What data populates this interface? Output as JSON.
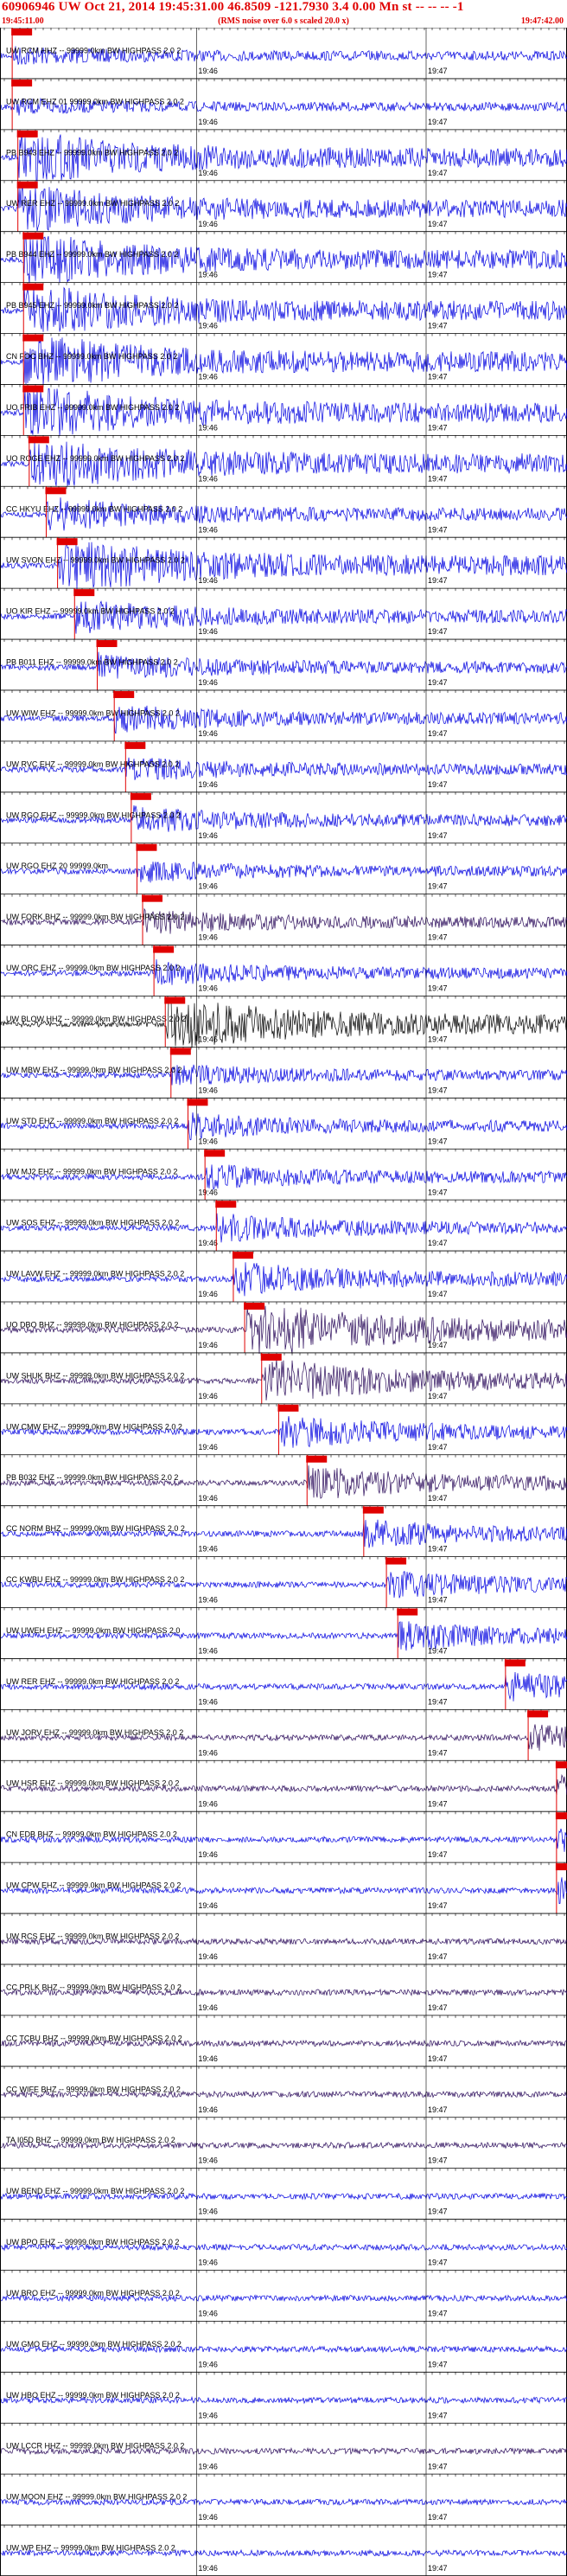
{
  "header": {
    "title": "60906946 UW Oct 21, 2014 19:45:31.00   46.8509 -121.7930  3.4 0.00 Mn st -- -- --   -1",
    "start_time": "19:45:11.00",
    "end_time": "19:47:42.00",
    "note": "(RMS noise over 6.0 s scaled 20.0 x)"
  },
  "minute_labels": [
    "19:46",
    "19:47"
  ],
  "colors": {
    "blue": "#0000e0",
    "purple": "#2a0a5a",
    "black": "#000000",
    "pick": "#e00000"
  },
  "traces": [
    {
      "label": "UW RCM HHZ -- 99999.0km BW HIGHPASS 2.0 2",
      "color": "blue",
      "amp": 0.25,
      "pick": 0.02
    },
    {
      "label": "UW RCM EHZ 01 99999.0km BW HIGHPASS 2.0 2",
      "color": "blue",
      "amp": 0.2,
      "pick": 0.02
    },
    {
      "label": "PB B943 EHZ -- 99999.0km BW HIGHPASS 2.0 2",
      "color": "blue",
      "amp": 0.9,
      "pick": 0.03
    },
    {
      "label": "UW RER EHZ -- 99999.0km BW HIGHPASS 2.0 2",
      "color": "blue",
      "amp": 0.8,
      "pick": 0.03
    },
    {
      "label": "PB B944 EHZ -- 99999.0km BW HIGHPASS 2.0 2",
      "color": "blue",
      "amp": 0.9,
      "pick": 0.04
    },
    {
      "label": "PB B945 EHZ -- 99999.0km BW HIGHPASS 2.0 2",
      "color": "blue",
      "amp": 0.9,
      "pick": 0.04
    },
    {
      "label": "CN FOC BHZ -- 99999.0km BW HIGHPASS 2.0 2",
      "color": "blue",
      "amp": 0.95,
      "pick": 0.04
    },
    {
      "label": "UO FRIB EHZ -- 99999.0km BW HIGHPASS 2.0 2",
      "color": "blue",
      "amp": 0.95,
      "pick": 0.04
    },
    {
      "label": "UO ROGE EHZ -- 99999.0km BW HIGHPASS 2.0 2",
      "color": "blue",
      "amp": 0.95,
      "pick": 0.05
    },
    {
      "label": "CC HKYU EHZ -- 99999.0km BW HIGHPASS 2.0 2",
      "color": "blue",
      "amp": 0.5,
      "pick": 0.08
    },
    {
      "label": "UW SVON EHZ -- 99999.0km BW HIGHPASS 2.0 2",
      "color": "blue",
      "amp": 0.95,
      "pick": 0.1
    },
    {
      "label": "UO KIR EHZ -- 99999.0km BW HIGHPASS 2.0 2",
      "color": "blue",
      "amp": 0.5,
      "pick": 0.13
    },
    {
      "label": "PB B011 EHZ -- 99999.0km BW HIGHPASS 2.0 2",
      "color": "blue",
      "amp": 0.4,
      "pick": 0.17
    },
    {
      "label": "UW WIW EHZ -- 99999.0km BW HIGHPASS 2.0 2",
      "color": "blue",
      "amp": 0.4,
      "pick": 0.2
    },
    {
      "label": "UW RVC EHZ -- 99999.0km BW HIGHPASS 2.0 2",
      "color": "blue",
      "amp": 0.35,
      "pick": 0.22
    },
    {
      "label": "UW RGO EHZ -- 99999.0km BW HIGHPASS 2.0 2",
      "color": "blue",
      "amp": 0.4,
      "pick": 0.23
    },
    {
      "label": "UW RGO EHZ 20 99999.0km",
      "color": "blue",
      "amp": 0.3,
      "pick": 0.24
    },
    {
      "label": "UW FORK BHZ -- 99999.0km BW HIGHPASS 2.0 2",
      "color": "purple",
      "amp": 0.35,
      "pick": 0.25
    },
    {
      "label": "UW ORC EHZ -- 99999.0km BW HIGHPASS 2.0 2",
      "color": "blue",
      "amp": 0.35,
      "pick": 0.27
    },
    {
      "label": "UW BLOW HHZ -- 99999.0km BW HIGHPASS 2.0 2",
      "color": "black",
      "amp": 0.9,
      "pick": 0.29
    },
    {
      "label": "UW MBW EHZ -- 99999.0km BW HIGHPASS 2.0 2",
      "color": "blue",
      "amp": 0.3,
      "pick": 0.3
    },
    {
      "label": "UW STD EHZ -- 99999.0km BW HIGHPASS 2.0 2",
      "color": "blue",
      "amp": 0.35,
      "pick": 0.33
    },
    {
      "label": "UW MJ2 EHZ -- 99999.0km BW HIGHPASS 2.0 2",
      "color": "blue",
      "amp": 0.35,
      "pick": 0.36
    },
    {
      "label": "UW SOS EHZ -- 99999.0km BW HIGHPASS 2.0 2",
      "color": "blue",
      "amp": 0.4,
      "pick": 0.38
    },
    {
      "label": "UW LAVW EHZ -- 99999.0km BW HIGHPASS 2.0 2",
      "color": "blue",
      "amp": 0.5,
      "pick": 0.41
    },
    {
      "label": "UO DBO BHZ -- 99999.0km BW HIGHPASS 2.0 2",
      "color": "purple",
      "amp": 0.95,
      "pick": 0.43
    },
    {
      "label": "UW SHUK BHZ -- 99999.0km BW HIGHPASS 2.0 2",
      "color": "purple",
      "amp": 0.7,
      "pick": 0.46
    },
    {
      "label": "UW CMW EHZ -- 99999.0km BW HIGHPASS 2.0 2",
      "color": "blue",
      "amp": 0.5,
      "pick": 0.49
    },
    {
      "label": "PB B032 EHZ -- 99999.0km BW HIGHPASS 2.0 2",
      "color": "purple",
      "amp": 0.5,
      "pick": 0.54
    },
    {
      "label": "CC NORM BHZ -- 99999.0km BW HIGHPASS 2.0 2",
      "color": "blue",
      "amp": 0.4,
      "pick": 0.64
    },
    {
      "label": "CC KWBU EHZ -- 99999.0km BW HIGHPASS 2.0 2",
      "color": "blue",
      "amp": 0.4,
      "pick": 0.68
    },
    {
      "label": "UW UWEH EHZ -- 99999.0km BW HIGHPASS 2.0",
      "color": "blue",
      "amp": 0.45,
      "pick": 0.7
    },
    {
      "label": "UW RER EHZ -- 99999.0km BW HIGHPASS 2.0 2",
      "color": "blue",
      "amp": 0.4,
      "pick": 0.89
    },
    {
      "label": "UW JORV EHZ -- 99999.0km BW HIGHPASS 2.0 2",
      "color": "purple",
      "amp": 0.35,
      "pick": 0.93
    },
    {
      "label": "UW HSR EHZ -- 99999.0km BW HIGHPASS 2.0 2",
      "color": "purple",
      "amp": 0.35,
      "pick": 0.98
    },
    {
      "label": "CN EDB BHZ -- 99999.0km BW HIGHPASS 2.0 2",
      "color": "blue",
      "amp": 0.35,
      "pick": 0.98
    },
    {
      "label": "UW CPW EHZ -- 99999.0km BW HIGHPASS 2.0 2",
      "color": "blue",
      "amp": 0.35,
      "pick": 0.98
    },
    {
      "label": "UW RCS EHZ -- 99999.0km BW HIGHPASS 2.0 2",
      "color": "purple",
      "amp": 0.55,
      "pick": null
    },
    {
      "label": "CC PRLK BHZ -- 99999.0km BW HIGHPASS 2.0 2",
      "color": "purple",
      "amp": 0.3,
      "pick": null
    },
    {
      "label": "CC TCBU BHZ -- 99999.0km BW HIGHPASS 2.0 2",
      "color": "purple",
      "amp": 0.3,
      "pick": null
    },
    {
      "label": "CC WIFE BHZ -- 99999.0km BW HIGHPASS 2.0 2",
      "color": "purple",
      "amp": 0.3,
      "pick": null
    },
    {
      "label": "TA I05D BHZ -- 99999.0km BW HIGHPASS 2.0 2",
      "color": "purple",
      "amp": 0.3,
      "pick": null
    },
    {
      "label": "UW BEND EHZ -- 99999.0km BW HIGHPASS 2.0 2",
      "color": "blue",
      "amp": 0.3,
      "pick": null
    },
    {
      "label": "UW BPO EHZ -- 99999.0km BW HIGHPASS 2.0 2",
      "color": "blue",
      "amp": 0.3,
      "pick": null
    },
    {
      "label": "UW BRO EHZ -- 99999.0km BW HIGHPASS 2.0 2",
      "color": "blue",
      "amp": 0.3,
      "pick": null
    },
    {
      "label": "UW GMO EHZ -- 99999.0km BW HIGHPASS 2.0 2",
      "color": "blue",
      "amp": 0.3,
      "pick": null
    },
    {
      "label": "UW HBO EHZ -- 99999.0km BW HIGHPASS 2.0 2",
      "color": "blue",
      "amp": 0.3,
      "pick": null
    },
    {
      "label": "UW LCCR HHZ -- 99999.0km BW HIGHPASS 2.0 2",
      "color": "purple",
      "amp": 0.3,
      "pick": null
    },
    {
      "label": "UW MOON EHZ -- 99999.0km BW HIGHPASS 2.0 2",
      "color": "blue",
      "amp": 0.3,
      "pick": null
    },
    {
      "label": "UW WP EHZ -- 99999.0km BW HIGHPASS 2.0 2",
      "color": "blue",
      "amp": 0.3,
      "pick": null
    }
  ]
}
